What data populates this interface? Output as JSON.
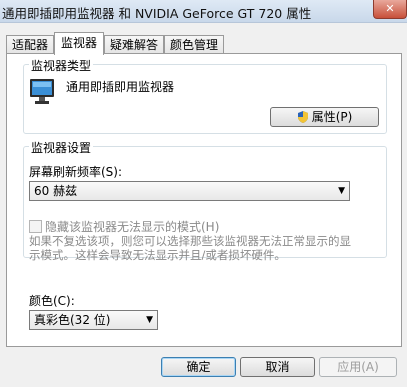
{
  "window": {
    "title": "通用即插即用监视器 和 NVIDIA GeForce GT 720  属性",
    "close_label": "✕"
  },
  "tabs": [
    {
      "label": "适配器"
    },
    {
      "label": "监视器"
    },
    {
      "label": "疑难解答"
    },
    {
      "label": "颜色管理"
    }
  ],
  "monitor_type": {
    "legend": "监视器类型",
    "name": "通用即插即用监视器",
    "properties_button": "属性(P)"
  },
  "monitor_settings": {
    "legend": "监视器设置",
    "refresh_label": "屏幕刷新频率(S):",
    "refresh_value": "60 赫兹",
    "hide_modes_label": "隐藏该监视器无法显示的模式(H)",
    "hide_modes_checked": false,
    "note": "如果不复选该项，则您可以选择那些该监视器无法正常显示的显示模式。这样会导致无法显示并且/或者损坏硬件。"
  },
  "colors": {
    "label": "颜色(C):",
    "value": "真彩色(32 位)"
  },
  "footer": {
    "ok": "确定",
    "cancel": "取消",
    "apply": "应用(A)"
  }
}
